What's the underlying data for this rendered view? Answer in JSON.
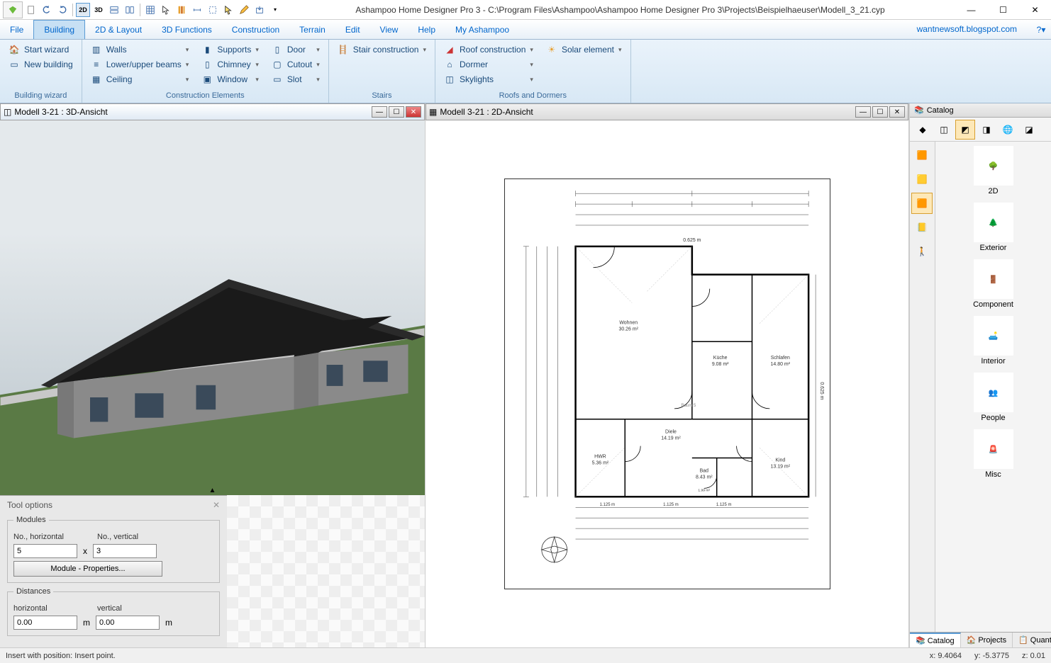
{
  "title": "Ashampoo Home Designer Pro 3 - C:\\Program Files\\Ashampoo\\Ashampoo Home Designer Pro 3\\Projects\\Beispielhaeuser\\Modell_3_21.cyp",
  "blog": "wantnewsoft.blogspot.com",
  "menus": [
    "File",
    "Building",
    "2D & Layout",
    "3D Functions",
    "Construction",
    "Terrain",
    "Edit",
    "View",
    "Help",
    "My Ashampoo"
  ],
  "active_menu": 1,
  "ribbon_groups": {
    "bw": {
      "label": "Building wizard",
      "items": [
        "Start wizard",
        "New building"
      ]
    },
    "ce": {
      "label": "Construction Elements",
      "col1": [
        "Walls",
        "Lower/upper beams",
        "Ceiling"
      ],
      "col2": [
        "Supports",
        "Chimney",
        "Window"
      ],
      "col3": [
        "Door",
        "Cutout",
        "Slot"
      ]
    },
    "st": {
      "label": "Stairs",
      "items": [
        "Stair construction"
      ]
    },
    "rd": {
      "label": "Roofs and Dormers",
      "col1": [
        "Roof construction",
        "Dormer",
        "Skylights"
      ],
      "col2": [
        "Solar element"
      ]
    }
  },
  "view3d_title": "Modell 3-21 : 3D-Ansicht",
  "view2d_title": "Modell 3-21 : 2D-Ansicht",
  "tool_options": {
    "title": "Tool options",
    "modules_label": "Modules",
    "no_h_label": "No., horizontal",
    "no_v_label": "No., vertical",
    "no_h": "5",
    "no_v": "3",
    "x": "x",
    "props_btn": "Module - Properties...",
    "distances_label": "Distances",
    "horizontal_label": "horizontal",
    "vertical_label": "vertical",
    "dist_h": "0.00",
    "dist_v": "0.00",
    "unit": "m"
  },
  "catalog": {
    "header": "Catalog",
    "items": [
      "2D",
      "Exterior",
      "Component",
      "Interior",
      "People",
      "Misc"
    ],
    "tabs": [
      "Catalog",
      "Projects",
      "Quantities"
    ],
    "active_tab": 0
  },
  "status": {
    "message": "Insert with position: Insert point.",
    "x_label": "x:",
    "x": "9.4064",
    "y_label": "y:",
    "y": "-5.3775",
    "z_label": "z:",
    "z": "0.01"
  },
  "floorplan": {
    "width_label": "0.625 m",
    "rooms": {
      "wohnen": {
        "name": "Wohnen",
        "area": "30.26 m²"
      },
      "kueche": {
        "name": "Küche",
        "area": "9.08 m²"
      },
      "schlafen": {
        "name": "Schlafen",
        "area": "14.80 m²"
      },
      "diele": {
        "name": "Diele",
        "area": "14.19 m²"
      },
      "hwr": {
        "name": "HWR",
        "area": "5.36 m²"
      },
      "bad": {
        "name": "Bad",
        "area": "8.43 m²",
        "extra": "1.99 m²"
      },
      "kind": {
        "name": "Kind",
        "area": "13.19 m²"
      },
      "raum5": "Raum 5"
    },
    "dims_bottom": [
      "1.125 m",
      "1.125 m",
      "1.125 m"
    ]
  }
}
